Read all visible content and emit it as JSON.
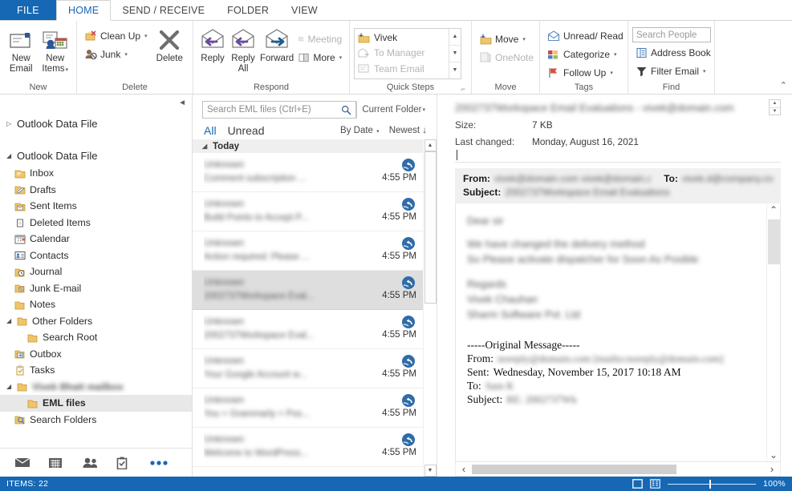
{
  "window": {
    "title": "Outlook - EML files"
  },
  "tabs": [
    {
      "id": "file",
      "label": "FILE",
      "active": false
    },
    {
      "id": "home",
      "label": "HOME",
      "active": true
    },
    {
      "id": "send",
      "label": "SEND / RECEIVE",
      "active": false
    },
    {
      "id": "folder",
      "label": "FOLDER",
      "active": false
    },
    {
      "id": "view",
      "label": "VIEW",
      "active": false
    }
  ],
  "ribbon": {
    "groups": [
      {
        "title": "New",
        "dialog_launcher": false
      },
      {
        "title": "Delete",
        "dialog_launcher": false
      },
      {
        "title": "Respond",
        "dialog_launcher": false
      },
      {
        "title": "Quick Steps",
        "dialog_launcher": true
      },
      {
        "title": "Move",
        "dialog_launcher": false
      },
      {
        "title": "Tags",
        "dialog_launcher": false
      },
      {
        "title": "Find",
        "dialog_launcher": false
      }
    ],
    "new_group": {
      "new_email": "New\nEmail",
      "new_email_l1": "New",
      "new_email_l2": "Email",
      "new_items_l1": "New",
      "new_items_l2": "Items"
    },
    "delete_group": {
      "clean_up": "Clean Up",
      "junk": "Junk",
      "delete": "Delete"
    },
    "respond_group": {
      "reply": "Reply",
      "reply_all_l1": "Reply",
      "reply_all_l2": "All",
      "forward": "Forward",
      "meeting": "Meeting",
      "more": "More"
    },
    "quick_steps": {
      "items": [
        "Vivek",
        "To Manager",
        "Team Email"
      ]
    },
    "move_group": {
      "move": "Move",
      "onenote": "OneNote"
    },
    "tags_group": {
      "unread_read": "Unread/ Read",
      "categorize": "Categorize",
      "follow_up": "Follow Up"
    },
    "find_group": {
      "search_people_placeholder": "Search People",
      "address_book": "Address Book",
      "filter_email": "Filter Email"
    }
  },
  "sidebar": {
    "root_collapsed": {
      "label": "Outlook Data File"
    },
    "root_expanded": {
      "label": "Outlook Data File"
    },
    "folders": [
      {
        "label": "Inbox",
        "icon": "inbox-icon",
        "indent": 1,
        "selected": false,
        "blurred": false
      },
      {
        "label": "Drafts",
        "icon": "drafts-icon",
        "indent": 1,
        "selected": false,
        "blurred": false
      },
      {
        "label": "Sent Items",
        "icon": "sent-icon",
        "indent": 1,
        "selected": false,
        "blurred": false
      },
      {
        "label": "Deleted Items",
        "icon": "trash-icon",
        "indent": 1,
        "selected": false,
        "blurred": false
      },
      {
        "label": "Calendar",
        "icon": "calendar-icon",
        "indent": 1,
        "selected": false,
        "blurred": false
      },
      {
        "label": "Contacts",
        "icon": "contacts-icon",
        "indent": 1,
        "selected": false,
        "blurred": false
      },
      {
        "label": "Journal",
        "icon": "journal-icon",
        "indent": 1,
        "selected": false,
        "blurred": false
      },
      {
        "label": "Junk E-mail",
        "icon": "junk-icon",
        "indent": 1,
        "selected": false,
        "blurred": false
      },
      {
        "label": "Notes",
        "icon": "notes-icon",
        "indent": 1,
        "selected": false,
        "blurred": false
      },
      {
        "label": "Other Folders",
        "icon": "folder-icon",
        "indent": 1,
        "selected": false,
        "blurred": false,
        "expander": "down"
      },
      {
        "label": "Search Root",
        "icon": "folder-icon",
        "indent": 2,
        "selected": false,
        "blurred": false
      },
      {
        "label": "Outbox",
        "icon": "outbox-icon",
        "indent": 1,
        "selected": false,
        "blurred": false
      },
      {
        "label": "Tasks",
        "icon": "tasks-icon",
        "indent": 1,
        "selected": false,
        "blurred": false
      },
      {
        "label": "Vivek Bhatt mailbox",
        "icon": "folder-icon",
        "indent": 1,
        "selected": false,
        "blurred": true,
        "expander": "down"
      },
      {
        "label": "EML files",
        "icon": "folder-icon",
        "indent": 2,
        "selected": true,
        "blurred": false
      },
      {
        "label": "Search Folders",
        "icon": "search-folder-icon",
        "indent": 1,
        "selected": false,
        "blurred": false
      }
    ],
    "nav_icons": [
      "mail-icon",
      "calendar-icon",
      "people-icon",
      "tasks-icon",
      "more-ellipsis-icon"
    ]
  },
  "message_list": {
    "search_placeholder": "Search EML files (Ctrl+E)",
    "scope_label": "Current Folder",
    "filter_all": "All",
    "filter_unread": "Unread",
    "sort_field": "By Date",
    "sort_order": "Newest",
    "group_header": "Today",
    "messages": [
      {
        "sender": "Unknown",
        "subject": "Comment subscription ...",
        "time": "4:55 PM",
        "selected": false
      },
      {
        "sender": "Unknown",
        "subject": "Build Points to Accept P...",
        "time": "4:55 PM",
        "selected": false
      },
      {
        "sender": "Unknown",
        "subject": "Action required: Please ...",
        "time": "4:55 PM",
        "selected": false
      },
      {
        "sender": "Unknown",
        "subject": "2002737Workspace Eval...",
        "time": "4:55 PM",
        "selected": true
      },
      {
        "sender": "Unknown",
        "subject": "2002737Workspace Eval...",
        "time": "4:55 PM",
        "selected": false
      },
      {
        "sender": "Unknown",
        "subject": "Your Google Account w...",
        "time": "4:55 PM",
        "selected": false
      },
      {
        "sender": "Unknown",
        "subject": "You + Grammarly = Pos...",
        "time": "4:55 PM",
        "selected": false
      },
      {
        "sender": "Unknown",
        "subject": "Welcome to WordPress...",
        "time": "4:55 PM",
        "selected": false
      }
    ]
  },
  "reading_pane": {
    "title_blurred": "2002737Workspace Email Evaluations - vivek@domain.com",
    "size_label": "Size:",
    "size_value": "7 KB",
    "last_changed_label": "Last changed:",
    "last_changed_value": "Monday, August 16, 2021",
    "from_label": "From:",
    "from_value": "vivek@domain.com vivek@domain.com",
    "to_label": "To:",
    "to_value": "vivek.d@company.com",
    "subject_label": "Subject:",
    "subject_value": "2002737Workspace Email Evaluations",
    "body_lines": [
      "Dear sir",
      "We have changed the delivery method",
      "So Please activate dispatcher for Soon As Posible",
      "Regards",
      "Vivek Chauhan",
      "Sharm Software Pvt. Ltd"
    ],
    "original_message": {
      "divider": "-----Original Message-----",
      "from_label": "From:",
      "from_value": "noreply@domain.com [mailto:noreply@domain.com]",
      "sent_label": "Sent:",
      "sent_value": "Wednesday, November 15, 2017 10:18 AM",
      "to_label": "To:",
      "to_value": "Sam K",
      "subject_label": "Subject:",
      "subject_value": "RE: 2002737Wk"
    }
  },
  "status_bar": {
    "items_label": "ITEMS: 22",
    "zoom_label": "100%"
  }
}
